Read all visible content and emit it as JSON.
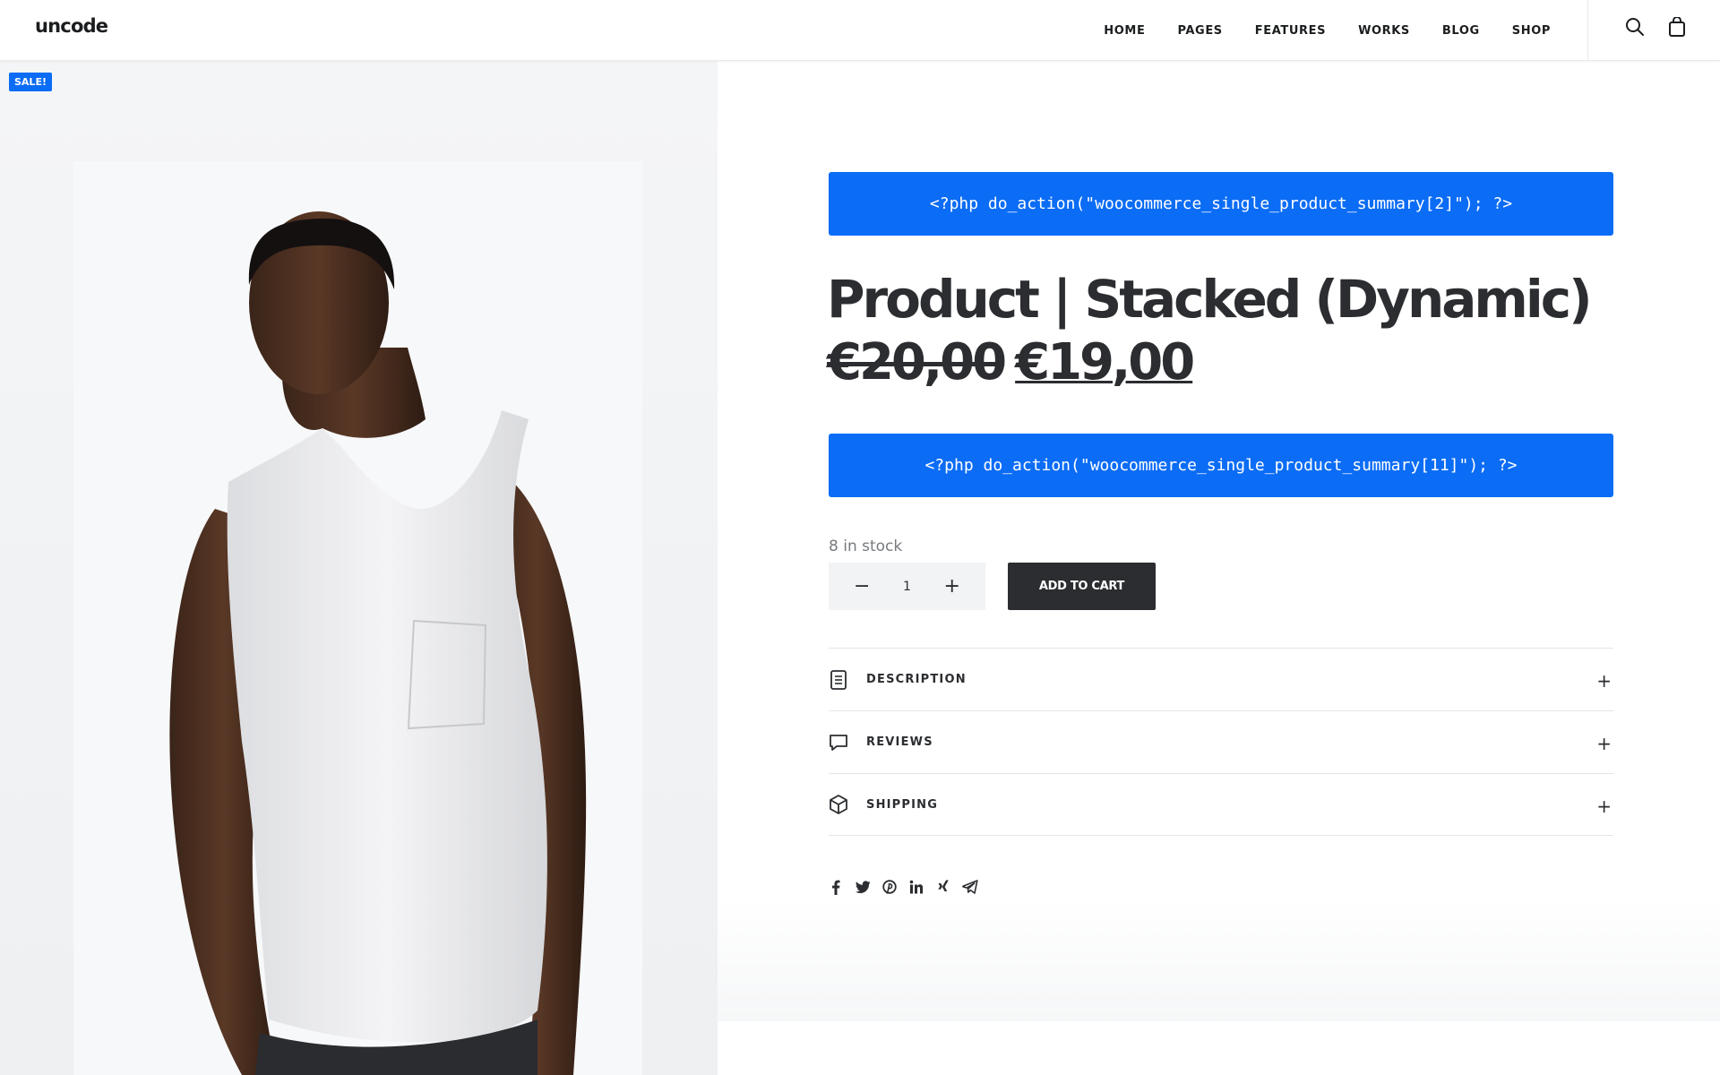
{
  "header": {
    "logo": "uncode",
    "nav": [
      "HOME",
      "PAGES",
      "FEATURES",
      "WORKS",
      "BLOG",
      "SHOP"
    ],
    "icons": [
      "search-icon",
      "shopping-bag-icon"
    ]
  },
  "product": {
    "sale_badge": "SALE!",
    "hook_top": "<?php do_action(\"woocommerce_single_product_summary[2]\"); ?>",
    "title": "Product | Stacked (Dynamic)",
    "price_old": "€20,00",
    "price_new": "€19,00",
    "hook_bottom": "<?php do_action(\"woocommerce_single_product_summary[11]\"); ?>",
    "stock": "8 in stock",
    "quantity": "1",
    "qty_minus": "−",
    "qty_plus": "+",
    "add_to_cart": "ADD TO CART"
  },
  "accordion": [
    {
      "label": "DESCRIPTION",
      "icon": "document-icon",
      "toggle": "+"
    },
    {
      "label": "REVIEWS",
      "icon": "speech-bubble-icon",
      "toggle": "+"
    },
    {
      "label": "SHIPPING",
      "icon": "box-icon",
      "toggle": "+"
    }
  ],
  "share": [
    "facebook-icon",
    "twitter-icon",
    "pinterest-icon",
    "linkedin-icon",
    "xing-icon",
    "telegram-icon"
  ],
  "colors": {
    "accent": "#0b6cf5",
    "dark": "#2b2d30",
    "muted": "#777a7e"
  }
}
